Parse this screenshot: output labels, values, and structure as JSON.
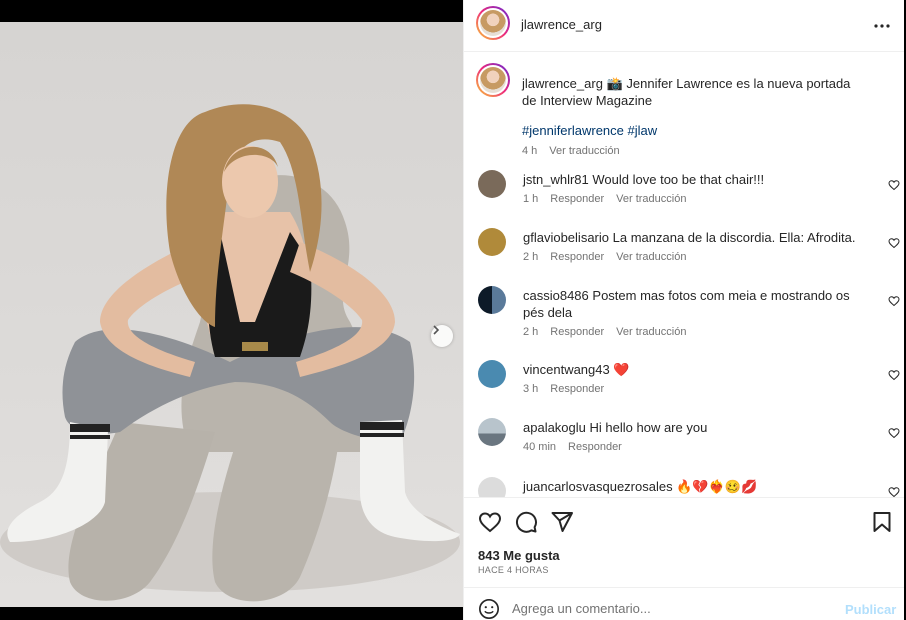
{
  "post": {
    "username": "jlawrence_arg",
    "more_icon": "more-horizontal-icon"
  },
  "caption": {
    "username": "jlawrence_arg",
    "emoji": "📸",
    "text": "Jennifer Lawrence es la nueva portada de Interview Magazine",
    "hashtags": "#jenniferlawrence #jlaw",
    "time": "4 h",
    "translate": "Ver traducción"
  },
  "comments": [
    {
      "username": "jstn_whlr81",
      "text": "Would love too be that chair!!!",
      "time": "1 h",
      "reply": "Responder",
      "translate": "Ver traducción",
      "avatar_color": "#7a6a5a"
    },
    {
      "username": "gflaviobelisario",
      "text": "La manzana de la discordia. Ella: Afrodita.",
      "time": "2 h",
      "reply": "Responder",
      "translate": "Ver traducción",
      "avatar_color": "#b08a3a"
    },
    {
      "username": "cassio8486",
      "text": "Postem mas fotos com meia e mostrando os pés dela",
      "time": "2 h",
      "reply": "Responder",
      "translate": "Ver traducción",
      "avatar_color": "#1a2a3a"
    },
    {
      "username": "vincentwang43",
      "text": "❤️",
      "time": "3 h",
      "reply": "Responder",
      "translate": "",
      "avatar_color": "#4a8ab0"
    },
    {
      "username": "apalakoglu",
      "text": "Hi hello how are you",
      "time": "40 min",
      "reply": "Responder",
      "translate": "",
      "avatar_color": "#8a9aa8"
    },
    {
      "username": "juancarlosvasquezrosales",
      "text": "🔥💔❤️‍🔥🥴💋",
      "time": "",
      "reply": "",
      "translate": "",
      "avatar_color": "#dcdcdc"
    }
  ],
  "actions": {
    "likes": "843 Me gusta",
    "time_ago": "HACE 4 HORAS"
  },
  "add_comment": {
    "placeholder": "Agrega un comentario...",
    "publish": "Publicar"
  },
  "colors": {
    "link": "#00376b",
    "secondary_text": "#737373",
    "publish_disabled": "#b2dffc",
    "heart_red": "#ed4956"
  }
}
